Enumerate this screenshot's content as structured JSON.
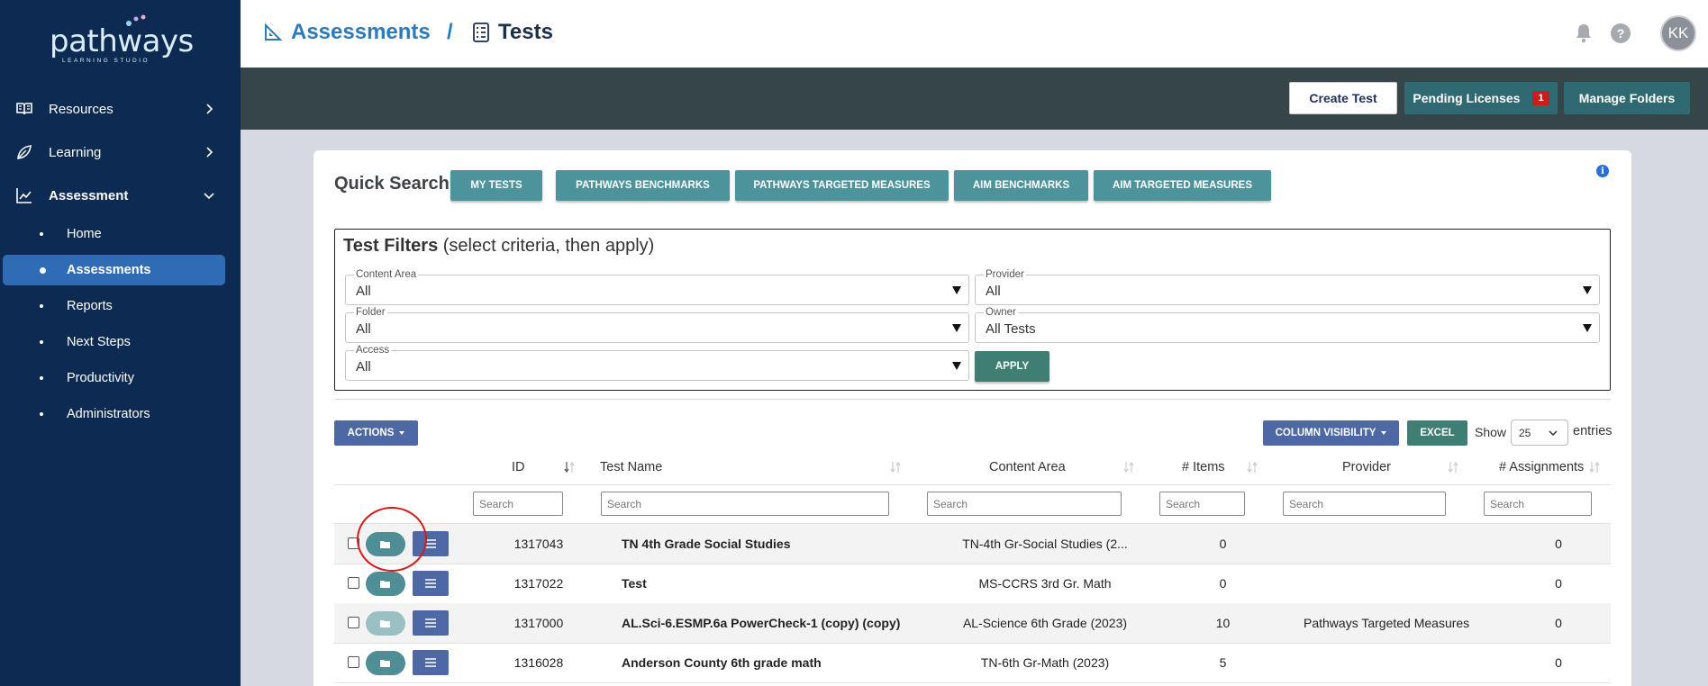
{
  "sidebar": {
    "logo_text": "pathways",
    "logo_sub": "LEARNING STUDIO",
    "items": [
      {
        "label": "Resources"
      },
      {
        "label": "Learning"
      },
      {
        "label": "Assessment"
      }
    ],
    "sub_items": [
      {
        "label": "Home"
      },
      {
        "label": "Assessments"
      },
      {
        "label": "Reports"
      },
      {
        "label": "Next Steps"
      },
      {
        "label": "Productivity"
      },
      {
        "label": "Administrators"
      }
    ]
  },
  "header": {
    "breadcrumb_parent": "Assessments",
    "breadcrumb_sep": "/",
    "breadcrumb_current": "Tests",
    "avatar_initials": "KK"
  },
  "toolbar": {
    "create_label": "Create Test",
    "pending_label": "Pending Licenses",
    "pending_count": "1",
    "manage_label": "Manage Folders"
  },
  "quick_search": {
    "label": "Quick Search",
    "buttons": [
      "MY TESTS",
      "PATHWAYS BENCHMARKS",
      "PATHWAYS TARGETED MEASURES",
      "AIM BENCHMARKS",
      "AIM TARGETED MEASURES"
    ]
  },
  "filters": {
    "title_bold": "Test Filters",
    "title_rest": " (select criteria, then apply)",
    "content_area": {
      "label": "Content Area",
      "value": "All"
    },
    "provider": {
      "label": "Provider",
      "value": "All"
    },
    "folder": {
      "label": "Folder",
      "value": "All"
    },
    "owner": {
      "label": "Owner",
      "value": "All Tests"
    },
    "access": {
      "label": "Access",
      "value": "All"
    },
    "apply_label": "APPLY"
  },
  "table_controls": {
    "actions_label": "ACTIONS",
    "column_visibility_label": "COLUMN VISIBILITY",
    "excel_label": "EXCEL",
    "show_label": "Show",
    "page_size": "25",
    "entries_label": "entries"
  },
  "table": {
    "columns": [
      "ID",
      "Test Name",
      "Content Area",
      "# Items",
      "Provider",
      "# Assignments"
    ],
    "search_placeholder": "Search",
    "rows": [
      {
        "id": "1317043",
        "name": "TN 4th Grade Social Studies",
        "content_area": "TN-4th Gr-Social Studies (2...",
        "items": "0",
        "provider": "",
        "assignments": "0"
      },
      {
        "id": "1317022",
        "name": "Test",
        "content_area": "MS-CCRS 3rd Gr. Math",
        "items": "0",
        "provider": "",
        "assignments": "0"
      },
      {
        "id": "1317000",
        "name": "AL.Sci-6.ESMP.6a PowerCheck-1 (copy) (copy)",
        "content_area": "AL-Science 6th Grade (2023)",
        "items": "10",
        "provider": "Pathways Targeted Measures",
        "assignments": "0"
      },
      {
        "id": "1316028",
        "name": "Anderson County 6th grade math",
        "content_area": "TN-6th Gr-Math (2023)",
        "items": "5",
        "provider": "",
        "assignments": "0"
      }
    ]
  },
  "colors": {
    "sidebar_bg": "#0d2b52",
    "active_nav": "#2f6cb5",
    "teal_button": "#4d939c",
    "blue_button": "#4d68a5",
    "green_button": "#3f7f73",
    "toolbar_bg": "#354548",
    "highlight": "#d61a1a"
  }
}
